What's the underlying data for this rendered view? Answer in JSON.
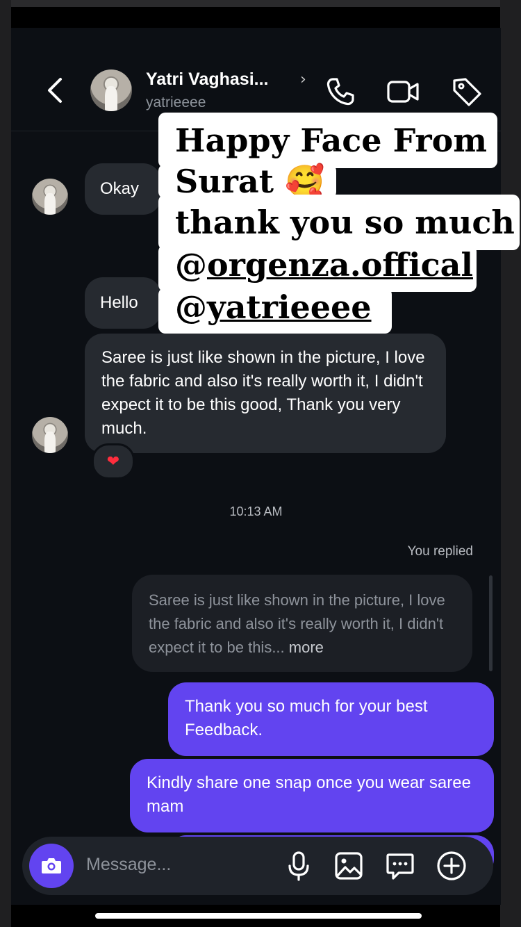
{
  "header": {
    "name": "Yatri Vaghasi...",
    "handle": "yatrieeee"
  },
  "messages": {
    "m1": "Okay",
    "m2": "Hello",
    "m3": "Saree is just like shown in the picture, I love the fabric and also it's really worth it, I didn't expect it to be this good, Thank you very much.",
    "reaction": "❤",
    "timestamp": "10:13 AM",
    "you_replied": "You replied",
    "quote": "Saree is just like shown in the picture, I love the fabric and also it's really worth it, I didn't expect it to be this...",
    "quote_more": "more",
    "sent1": "Thank you so much for your best Feedback.",
    "sent2": "Kindly share one snap once you wear saree mam"
  },
  "composer": {
    "placeholder": "Message..."
  },
  "overlay": {
    "line1": "Happy Face From",
    "line2": "Surat 🥰",
    "line3": "thank you so much",
    "line4_at": "@",
    "line4_handle": "orgenza.offical",
    "line5_at": "@",
    "line5_handle": "yatrieeee"
  },
  "colors": {
    "accent": "#6244f0",
    "bubble_received": "#262a30",
    "background": "#0c0f14"
  },
  "icons": [
    "back-icon",
    "phone-icon",
    "video-call-icon",
    "tag-icon",
    "camera-icon",
    "microphone-icon",
    "gallery-icon",
    "sticker-icon",
    "plus-icon",
    "heart-reaction-icon"
  ]
}
